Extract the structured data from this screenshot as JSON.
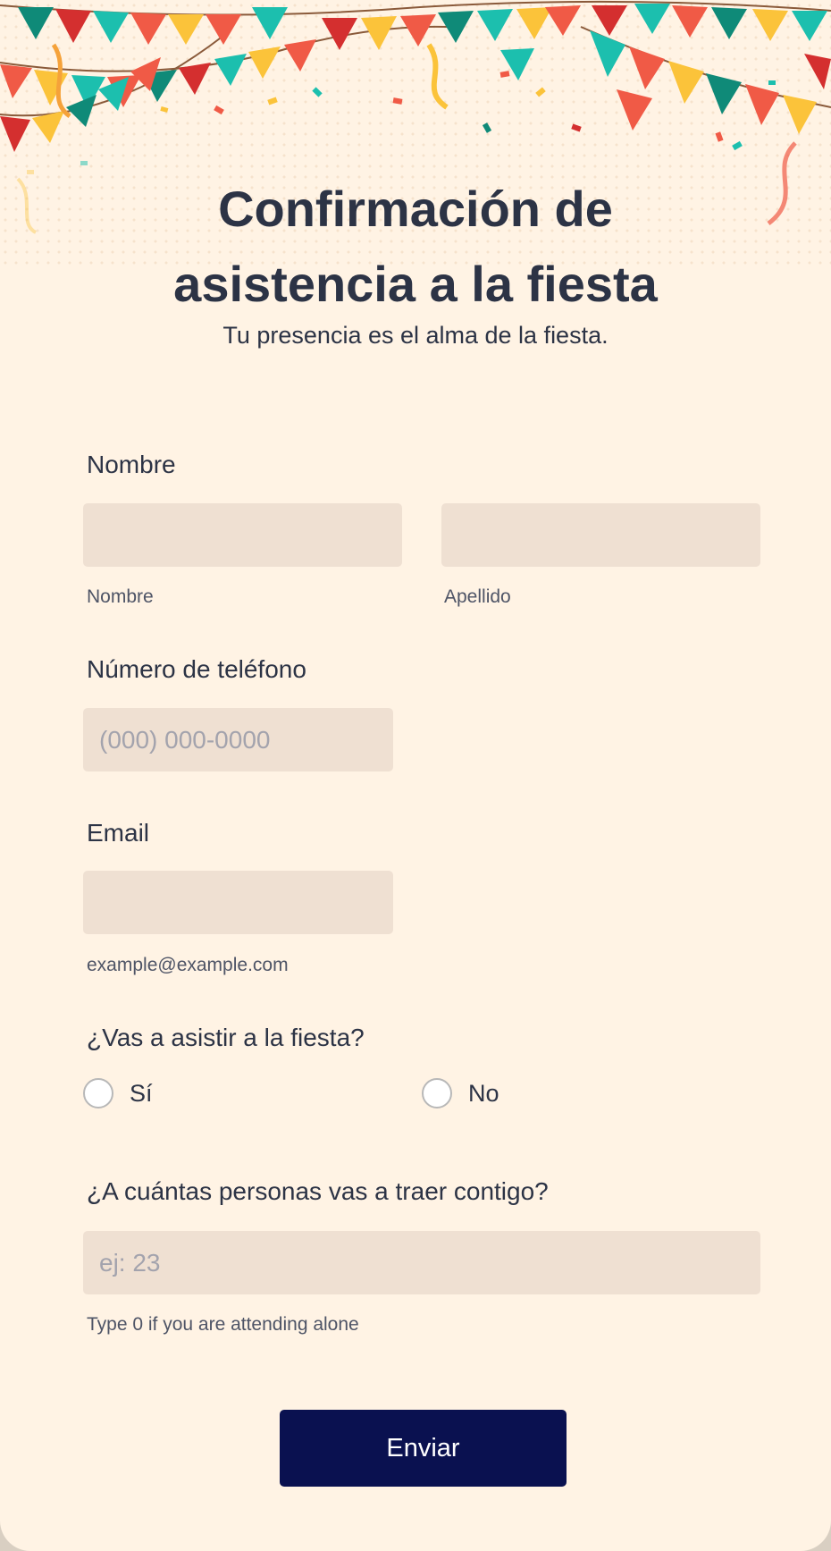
{
  "form": {
    "title_line1": "Confirmación de",
    "title_line2": "asistencia a la fiesta",
    "subtitle": "Tu presencia es el alma de la fiesta."
  },
  "name": {
    "label": "Nombre",
    "first_value": "",
    "first_sublabel": "Nombre",
    "last_value": "",
    "last_sublabel": "Apellido"
  },
  "phone": {
    "label": "Número de teléfono",
    "placeholder": "(000) 000-0000",
    "value": ""
  },
  "email": {
    "label": "Email",
    "value": "",
    "sublabel": "example@example.com"
  },
  "attend": {
    "label": "¿Vas a asistir a la fiesta?",
    "options": [
      "Sí",
      "No"
    ],
    "selected": null
  },
  "guests": {
    "label": "¿A cuántas personas vas a traer contigo?",
    "placeholder": "ej: 23",
    "value": "",
    "sublabel": "Type 0 if you are attending alone"
  },
  "submit": {
    "label": "Enviar"
  },
  "colors": {
    "page_bg": "#fff3e4",
    "input_bg": "#efe0d2",
    "text": "#2c3345",
    "button": "#0a1150",
    "bunting": [
      "#1cbfae",
      "#f05a46",
      "#fbc33a",
      "#0f8a78",
      "#d42f2f"
    ]
  }
}
